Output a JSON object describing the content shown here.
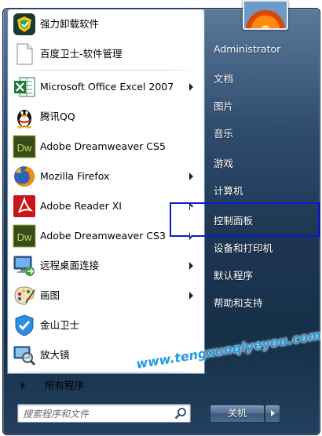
{
  "programs": [
    {
      "label": "强力卸载软件",
      "icon": "uninstaller-shield-icon",
      "submenu": false
    },
    {
      "label": "百度卫士-软件管理",
      "icon": "document-icon",
      "submenu": false
    },
    {
      "label": "Microsoft Office Excel 2007",
      "icon": "excel-icon",
      "submenu": true
    },
    {
      "label": "腾讯QQ",
      "icon": "qq-penguin-icon",
      "submenu": false
    },
    {
      "label": "Adobe Dreamweaver CS5",
      "icon": "dreamweaver-icon",
      "submenu": false
    },
    {
      "label": "Mozilla Firefox",
      "icon": "firefox-icon",
      "submenu": true
    },
    {
      "label": "Adobe Reader XI",
      "icon": "adobe-reader-icon",
      "submenu": true
    },
    {
      "label": "Adobe Dreamweaver CS3",
      "icon": "dreamweaver-icon",
      "submenu": true
    },
    {
      "label": "远程桌面连接",
      "icon": "remote-desktop-icon",
      "submenu": true
    },
    {
      "label": "画图",
      "icon": "paint-palette-icon",
      "submenu": true
    },
    {
      "label": "金山卫士",
      "icon": "kingsoft-shield-icon",
      "submenu": false
    },
    {
      "label": "放大镜",
      "icon": "magnifier-icon",
      "submenu": false
    }
  ],
  "all_programs": "所有程序",
  "search": {
    "placeholder": "搜索程序和文件"
  },
  "right": {
    "user": "Administrator",
    "items": [
      "文档",
      "图片",
      "音乐",
      "游戏",
      "计算机",
      "控制面板",
      "设备和打印机",
      "默认程序",
      "帮助和支持"
    ]
  },
  "shutdown": {
    "label": "关机"
  },
  "watermark": "www.tengxunqiyeyou.com",
  "colors": {
    "highlight_border": "#0a1ccf",
    "watermark": "#1e9be0"
  }
}
